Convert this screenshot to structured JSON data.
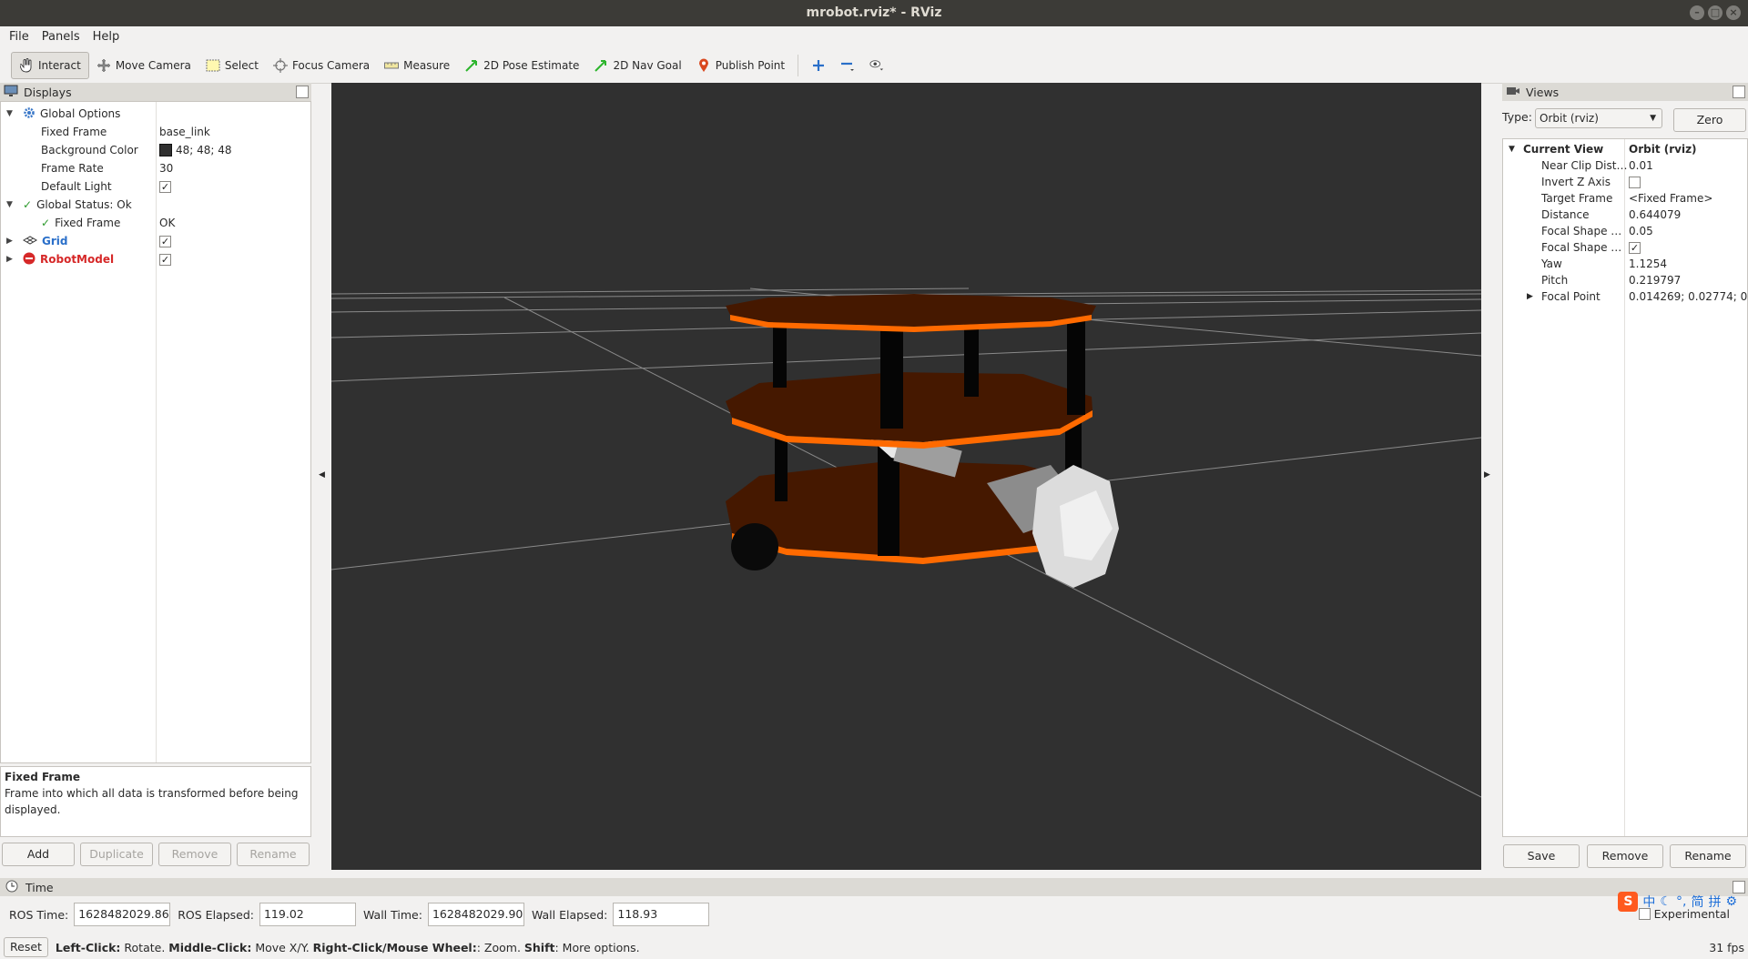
{
  "window": {
    "title": "mrobot.rviz* - RViz"
  },
  "menu": [
    "File",
    "Panels",
    "Help"
  ],
  "toolbar": {
    "interact": "Interact",
    "move_camera": "Move Camera",
    "select": "Select",
    "focus_camera": "Focus Camera",
    "measure": "Measure",
    "pose_estimate": "2D Pose Estimate",
    "nav_goal": "2D Nav Goal",
    "publish_point": "Publish Point"
  },
  "displays": {
    "title": "Displays",
    "global_options": "Global Options",
    "fixed_frame_label": "Fixed Frame",
    "fixed_frame_value": "base_link",
    "bg_color_label": "Background Color",
    "bg_color_value": "48; 48; 48",
    "frame_rate_label": "Frame Rate",
    "frame_rate_value": "30",
    "default_light_label": "Default Light",
    "global_status": "Global Status: Ok",
    "status_fixed_frame": "Fixed Frame",
    "status_fixed_frame_value": "OK",
    "grid": "Grid",
    "robot_model": "RobotModel",
    "desc_title": "Fixed Frame",
    "desc_text": "Frame into which all data is transformed before being displayed.",
    "buttons": {
      "add": "Add",
      "duplicate": "Duplicate",
      "remove": "Remove",
      "rename": "Rename"
    }
  },
  "views": {
    "title": "Views",
    "type_label": "Type:",
    "type_value": "Orbit (rviz)",
    "zero": "Zero",
    "current_view": "Current View",
    "current_view_value": "Orbit (rviz)",
    "props": [
      {
        "label": "Near Clip Dist…",
        "value": "0.01"
      },
      {
        "label": "Invert Z Axis",
        "value": ""
      },
      {
        "label": "Target Frame",
        "value": "<Fixed Frame>"
      },
      {
        "label": "Distance",
        "value": "0.644079"
      },
      {
        "label": "Focal Shape …",
        "value": "0.05"
      },
      {
        "label": "Focal Shape …",
        "value": ""
      },
      {
        "label": "Yaw",
        "value": "1.1254"
      },
      {
        "label": "Pitch",
        "value": "0.219797"
      },
      {
        "label": "Focal Point",
        "value": "0.014269; 0.02774; 0.…"
      }
    ],
    "buttons": {
      "save": "Save",
      "remove": "Remove",
      "rename": "Rename"
    }
  },
  "time": {
    "title": "Time",
    "ros_time_label": "ROS Time:",
    "ros_time": "1628482029.86",
    "ros_elapsed_label": "ROS Elapsed:",
    "ros_elapsed": "119.02",
    "wall_time_label": "Wall Time:",
    "wall_time": "1628482029.90",
    "wall_elapsed_label": "Wall Elapsed:",
    "wall_elapsed": "118.93",
    "experimental": "Experimental"
  },
  "status": {
    "reset": "Reset",
    "left_click": "Left-Click:",
    "left_click_desc": " Rotate. ",
    "middle_click": "Middle-Click:",
    "middle_click_desc": " Move X/Y. ",
    "right_click": "Right-Click/Mouse Wheel:",
    "right_click_desc": ": Zoom. ",
    "shift": "Shift",
    "shift_desc": ": More options.",
    "fps": "31 fps"
  },
  "ime": [
    "中",
    "简",
    "拼"
  ],
  "colors": {
    "robot_plate": "#4a1a00",
    "robot_edge": "#ff6a00",
    "background": "#303030"
  }
}
